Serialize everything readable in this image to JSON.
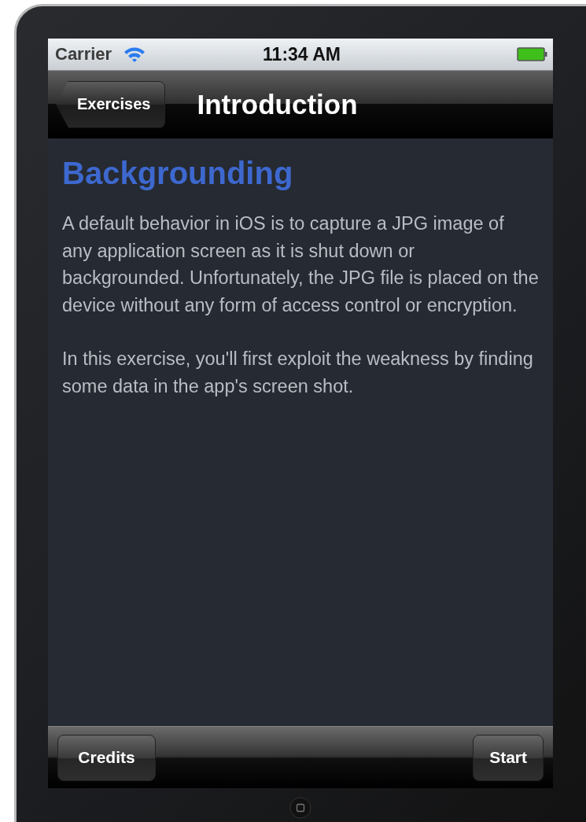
{
  "status_bar": {
    "carrier": "Carrier",
    "time": "11:34 AM"
  },
  "nav_bar": {
    "back_button": "Exercises",
    "title": "Introduction"
  },
  "content": {
    "heading": "Backgrounding",
    "paragraphs": [
      "A default behavior in iOS is to capture a JPG image of any application screen as it is shut down or backgrounded. Unfortunately, the JPG file is placed on the device without any form of access control or encryption.",
      "In this exercise, you'll first exploit the weakness by finding some data in the app's screen shot."
    ]
  },
  "toolbar": {
    "buttons": [
      "Credits",
      "Start"
    ]
  }
}
